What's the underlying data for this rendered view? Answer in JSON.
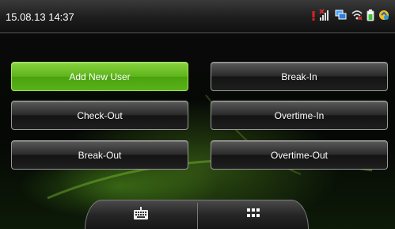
{
  "status_bar": {
    "datetime": "15.08.13 14:37",
    "icons": [
      "alert-icon",
      "signal-icon",
      "network-icon",
      "wifi-icon",
      "battery-icon",
      "sync-icon"
    ]
  },
  "menu": {
    "add_new_user": "Add New User",
    "break_in": "Break-In",
    "check_out": "Check-Out",
    "overtime_in": "Overtime-In",
    "break_out": "Break-Out",
    "overtime_out": "Overtime-Out"
  },
  "dock": {
    "items": [
      "keyboard-icon",
      "grid-menu-icon"
    ]
  },
  "colors": {
    "accent_green": "#5fb41c",
    "button_dark": "#2a2a2a"
  }
}
